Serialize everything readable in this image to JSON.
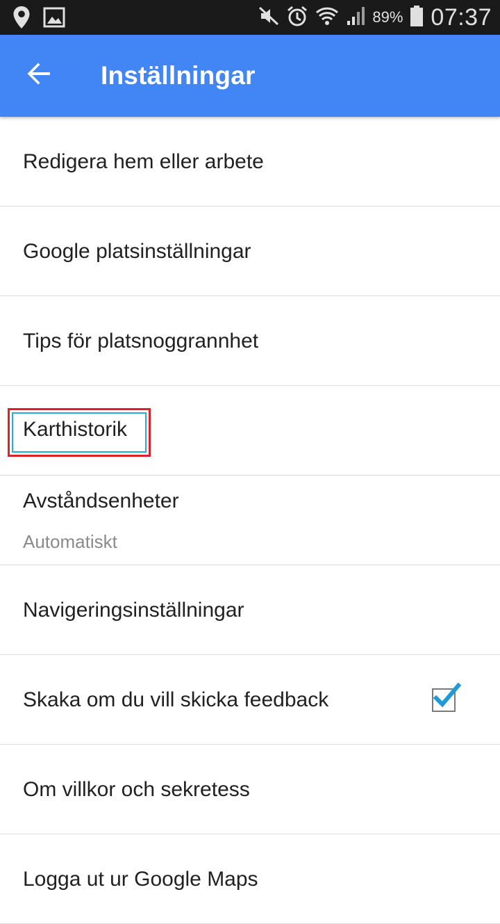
{
  "status_bar": {
    "icons_left": [
      "location-icon",
      "image-icon"
    ],
    "icons_right": [
      "mute-icon",
      "alarm-icon",
      "wifi-icon",
      "signal-icon"
    ],
    "battery_percent": "89%",
    "time": "07:37"
  },
  "app_bar": {
    "back_icon": "arrow-back-icon",
    "title": "Inställningar",
    "background": "#4285f4"
  },
  "settings": {
    "items": [
      {
        "label": "Redigera hem eller arbete"
      },
      {
        "label": "Google platsinställningar"
      },
      {
        "label": "Tips för platsnoggrannhet"
      },
      {
        "label": "Karthistorik",
        "highlighted": true
      },
      {
        "label": "Avståndsenheter",
        "sublabel": "Automatiskt"
      },
      {
        "label": "Navigeringsinställningar"
      },
      {
        "label": "Skaka om du vill skicka feedback",
        "checkbox": true,
        "checked": true
      },
      {
        "label": "Om villkor och sekretess"
      },
      {
        "label": "Logga ut ur Google Maps"
      }
    ]
  },
  "colors": {
    "highlight_outer": "#d8232a",
    "highlight_inner": "#29a8e0",
    "checkmark": "#1e9ad6"
  }
}
